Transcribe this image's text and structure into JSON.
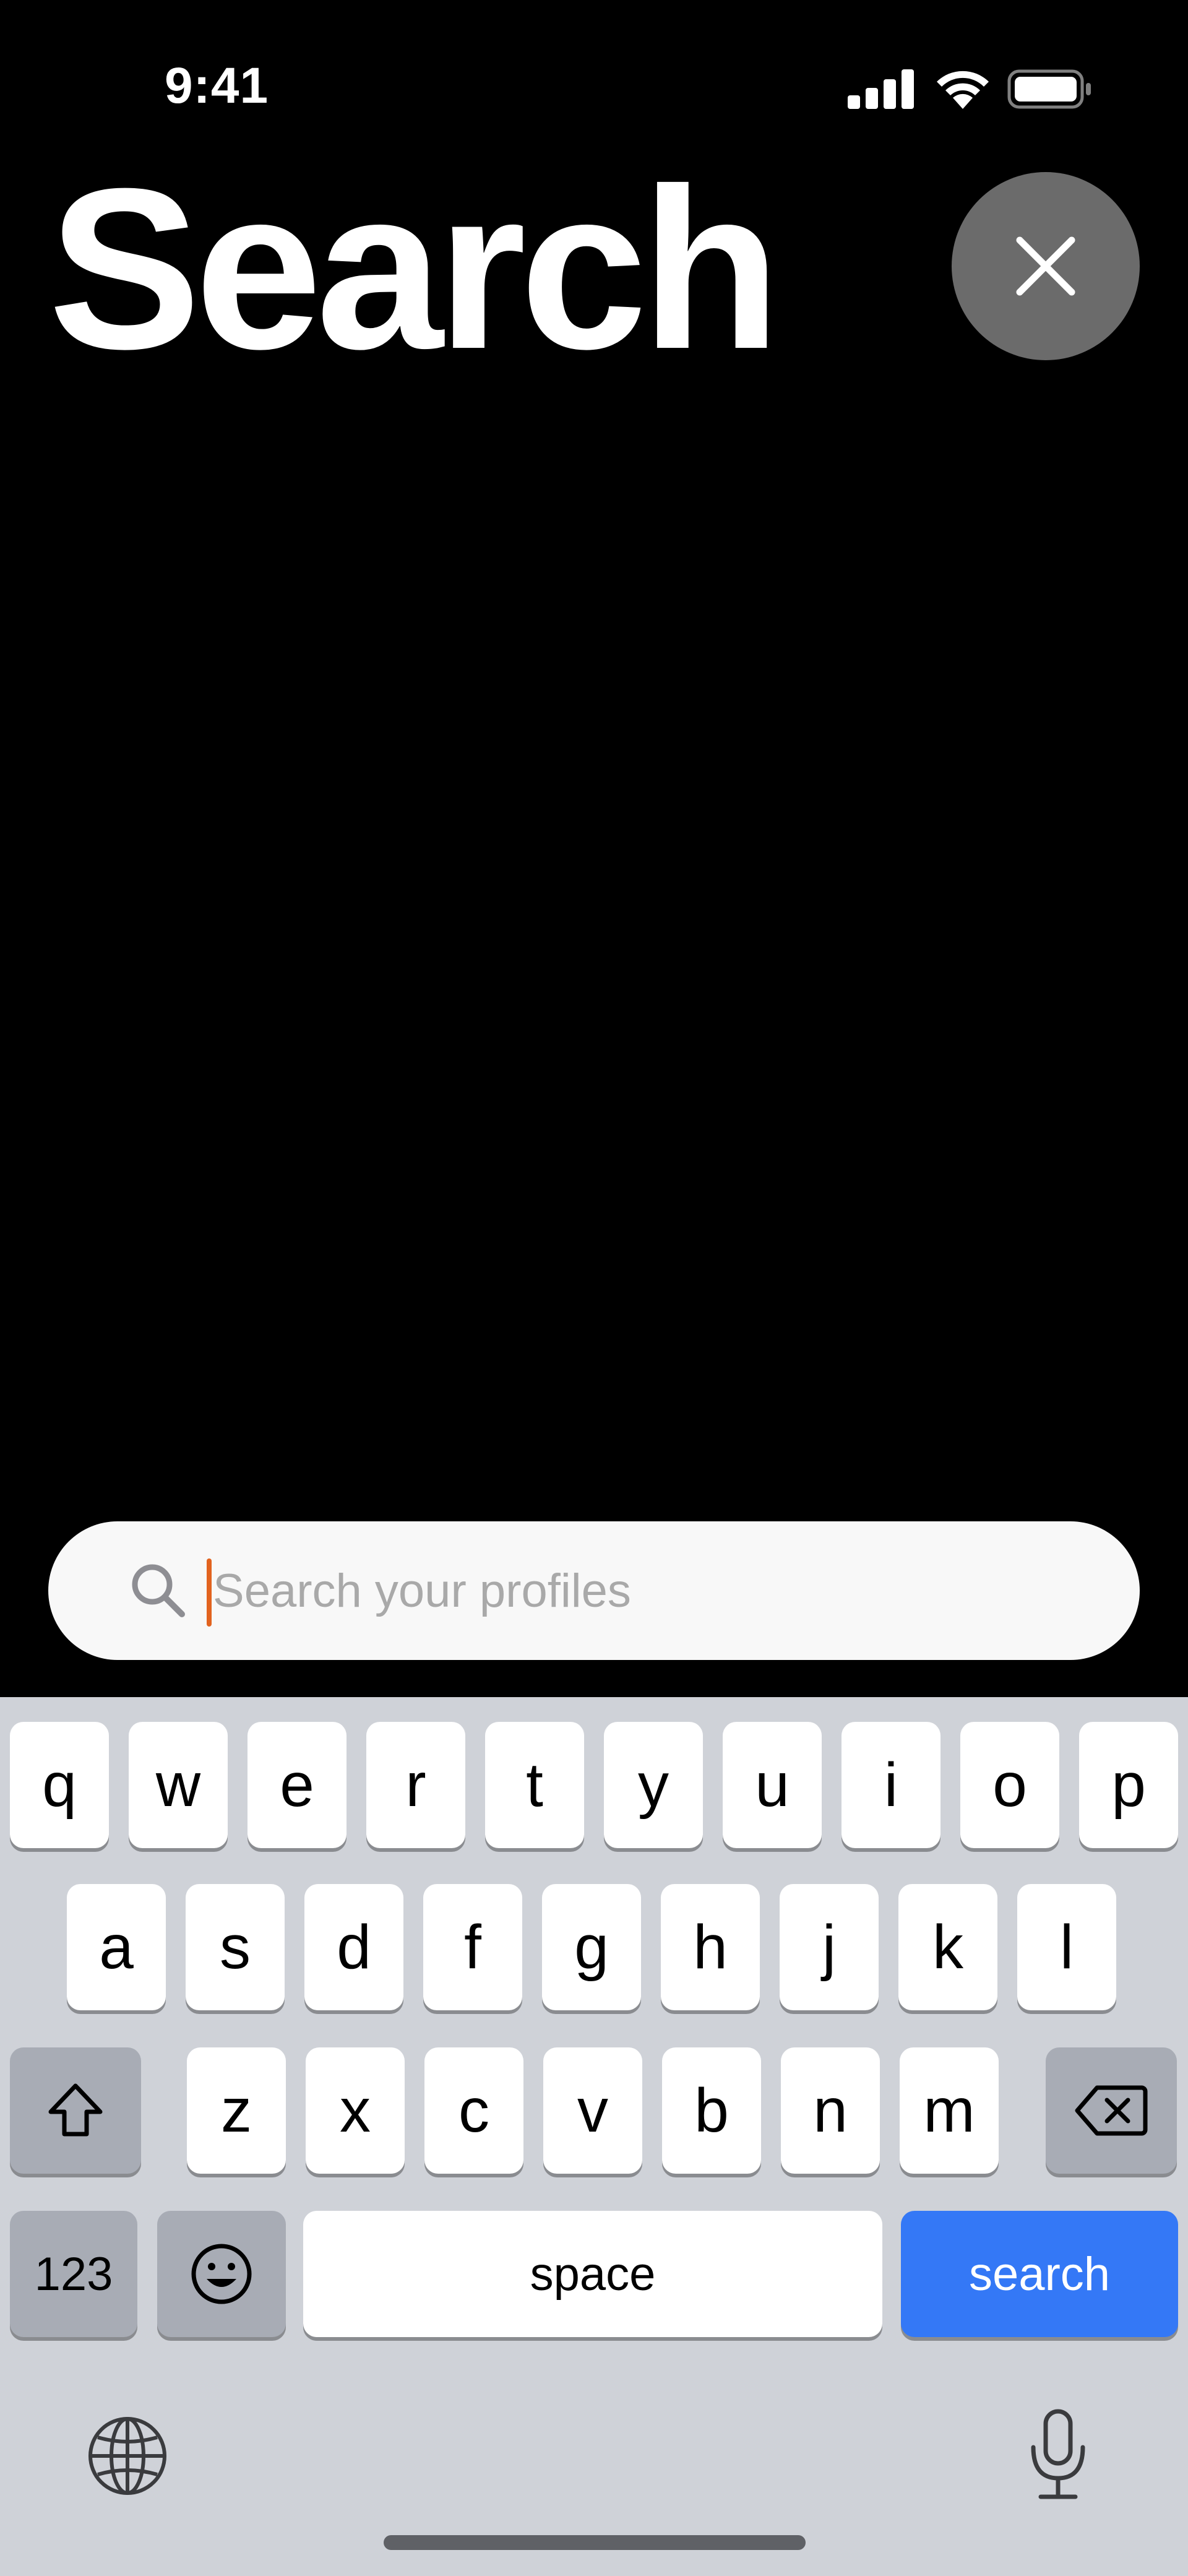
{
  "status_bar": {
    "time": "9:41",
    "icons": [
      "cellular-signal-icon",
      "wifi-icon",
      "battery-icon"
    ]
  },
  "header": {
    "title": "Search",
    "close_icon": "close-icon"
  },
  "search": {
    "placeholder": "Search your profiles",
    "value": "",
    "icon": "search-icon"
  },
  "keyboard": {
    "row1": [
      "q",
      "w",
      "e",
      "r",
      "t",
      "y",
      "u",
      "i",
      "o",
      "p"
    ],
    "row2": [
      "a",
      "s",
      "d",
      "f",
      "g",
      "h",
      "j",
      "k",
      "l"
    ],
    "row3": [
      "z",
      "x",
      "c",
      "v",
      "b",
      "n",
      "m"
    ],
    "shift_icon": "shift-icon",
    "delete_icon": "delete-icon",
    "numbers_label": "123",
    "emoji_icon": "emoji-icon",
    "space_label": "space",
    "action_label": "search",
    "globe_icon": "globe-icon",
    "mic_icon": "microphone-icon"
  },
  "colors": {
    "background": "#000000",
    "close_button": "#6b6b6b",
    "search_field": "#f8f8f8",
    "caret": "#e2631f",
    "keyboard_bg": "#cfd2d8",
    "key": "#ffffff",
    "special_key": "#a8acb5",
    "action_key": "#3478f6"
  }
}
